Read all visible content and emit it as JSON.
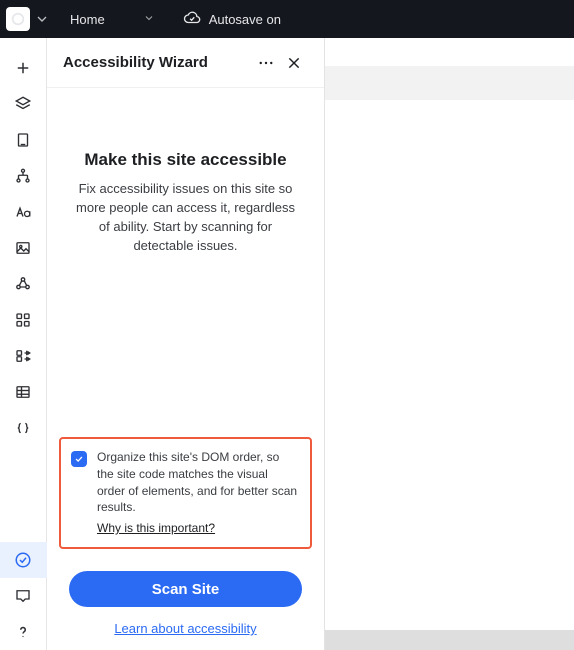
{
  "topbar": {
    "home_label": "Home",
    "autosave_label": "Autosave on"
  },
  "panel": {
    "title": "Accessibility Wizard",
    "heading": "Make this site accessible",
    "description": "Fix accessibility issues on this site so more people can access it, regardless of ability. Start by scanning for detectable issues.",
    "dom_card": {
      "checked": true,
      "text": "Organize this site's DOM order, so the site code matches the visual order of elements, and for better scan results.",
      "why_label": "Why is this important?"
    },
    "scan_label": "Scan Site",
    "learn_label": "Learn about accessibility"
  }
}
